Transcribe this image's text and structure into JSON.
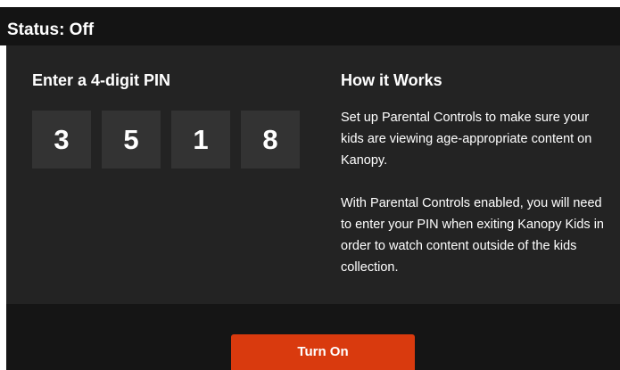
{
  "status": {
    "label": "Status: Off"
  },
  "pin": {
    "heading": "Enter a 4-digit PIN",
    "digits": [
      "3",
      "5",
      "1",
      "8"
    ]
  },
  "how_it_works": {
    "heading": "How it Works",
    "paragraphs": [
      "Set up Parental Controls to make sure your kids are viewing age-appropriate content on Kanopy.",
      "With Parental Controls enabled, you will need to enter your PIN when exiting Kanopy Kids in order to watch content outside of the kids collection."
    ]
  },
  "actions": {
    "turn_on_label": "Turn On"
  },
  "colors": {
    "status_bar_bg": "#141414",
    "panel_bg": "#232323",
    "pin_box_bg": "#333333",
    "footer_bg": "#151515",
    "button_bg": "#d93a0e",
    "text": "#ffffff"
  }
}
